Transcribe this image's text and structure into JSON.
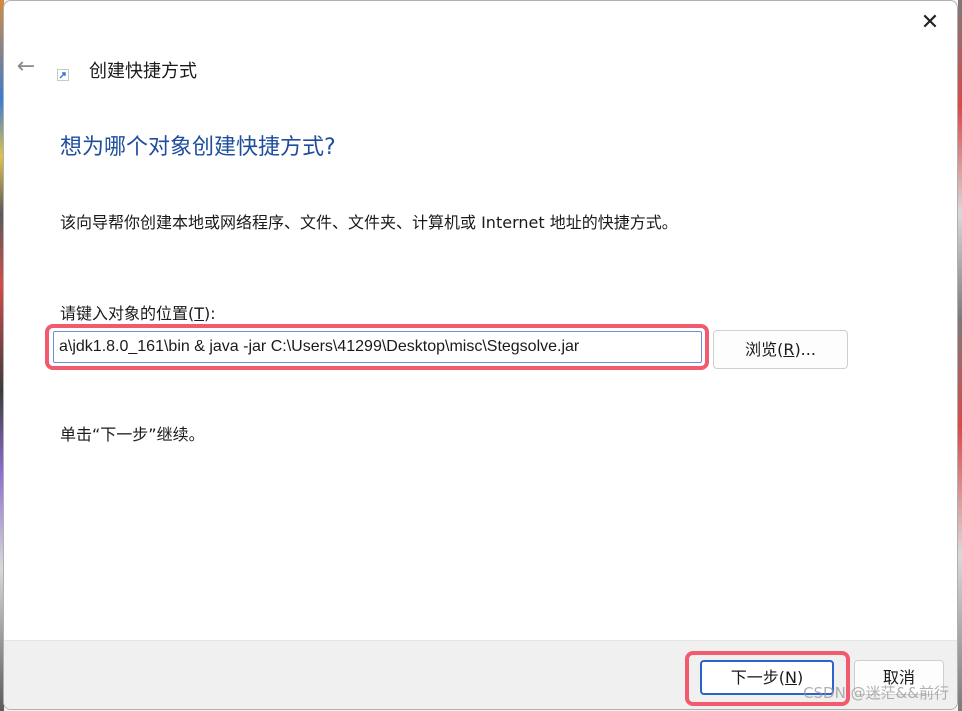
{
  "window": {
    "title": "创建快捷方式",
    "close_glyph": "✕",
    "back_glyph": "←"
  },
  "main": {
    "heading": "想为哪个对象创建快捷方式?",
    "description": "该向导帮你创建本地或网络程序、文件、文件夹、计算机或 Internet 地址的快捷方式。",
    "field_label_prefix": "请键入对象的位置(",
    "field_label_key": "T",
    "field_label_suffix": "):",
    "location_value": "a\\jdk1.8.0_161\\bin & java -jar C:\\Users\\41299\\Desktop\\misc\\Stegsolve.jar",
    "browse_prefix": "浏览(",
    "browse_key": "R",
    "browse_suffix": ")...",
    "hint": "单击“下一步”继续。"
  },
  "footer": {
    "next_prefix": "下一步(",
    "next_key": "N",
    "next_suffix": ")",
    "cancel_label": "取消"
  },
  "watermark": "CSDN @迷茫&&前行",
  "colors": {
    "heading": "#1f4e9c",
    "highlight": "#f25a6d",
    "primary_border": "#2a63c9"
  },
  "icons": [
    "close-icon",
    "back-arrow-icon",
    "shortcut-icon"
  ]
}
